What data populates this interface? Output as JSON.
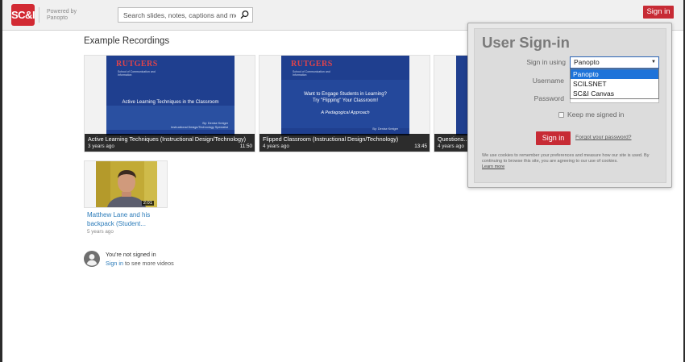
{
  "header": {
    "logo_text": "SC&I",
    "powered_line1": "Powered by",
    "powered_line2": "Panopto",
    "search_placeholder": "Search slides, notes, captions and more",
    "signin_label": "Sign in",
    "accent_color": "#c72b35"
  },
  "main": {
    "section_title": "Example Recordings",
    "recordings": [
      {
        "title": "Active Learning Techniques (Instructional Design/Technology)",
        "age": "3 years ago",
        "duration": "11:50",
        "slide_brand": "RUTGERS",
        "slide_brand_sub": "School of Communication and Information",
        "slide_text": "Active Learning Techniques in the Classroom",
        "slide_byline_1": "By: Denise Kreiger",
        "slide_byline_2": "Instructional Design/Technology Specialist"
      },
      {
        "title": "Flipped Classroom (Instructional Design/Technology)",
        "age": "4 years ago",
        "duration": "13:45",
        "slide_brand": "RUTGERS",
        "slide_brand_sub": "School of Communication and Information",
        "slide_text_1": "Want to Engage Students in Learning?",
        "slide_text_2": "Try \"Flipping\" Your Classroom!",
        "slide_text_3": "A Pedagogical Approach",
        "slide_byline_1": "By: Denise Kreiger"
      },
      {
        "title": "Questions...",
        "age": "4 years ago"
      }
    ],
    "featured": {
      "title": "Matthew Lane and his backpack (Student...",
      "age": "5 years ago",
      "duration": "2:01"
    },
    "not_signed_in": {
      "line1": "You're not signed in",
      "link": "Sign in",
      "line2_rest": "to see more videos"
    }
  },
  "signin_panel": {
    "title": "User Sign-in",
    "sign_in_using_label": "Sign in using",
    "selected_provider": "Panopto",
    "providers": [
      "Panopto",
      "SCILSNET",
      "SC&I Canvas"
    ],
    "username_label": "Username",
    "password_label": "Password",
    "keep_signed_in_label": "Keep me signed in",
    "signin_button": "Sign in",
    "forgot_link": "Forgot your password?",
    "cookie_notice": "We use cookies to remember your preferences and measure how our site is used. By continuing to browse this site, you are agreeing to our use of cookies.",
    "learn_more": "Learn more"
  }
}
